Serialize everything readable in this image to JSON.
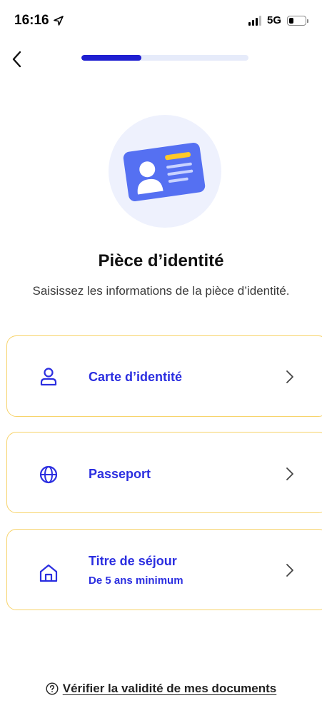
{
  "status_bar": {
    "time": "16:16",
    "location_icon": "location-arrow-icon",
    "network": "5G",
    "battery_level": 0.3
  },
  "nav": {
    "back_icon": "chevron-left-icon",
    "progress": 0.36
  },
  "hero": {
    "icon": "id-card-icon"
  },
  "header": {
    "title": "Pièce d’identité",
    "subtitle": "Saisissez les informations de la pièce d’identité."
  },
  "options": [
    {
      "label": "Carte d’identité",
      "icon": "user-icon"
    },
    {
      "label": "Passeport",
      "icon": "globe-icon"
    },
    {
      "label": "Titre de séjour",
      "sublabel": "De 5 ans minimum",
      "icon": "home-icon"
    }
  ],
  "footer": {
    "link": "Vérifier la validité de mes documents",
    "icon": "help-circle-icon"
  },
  "colors": {
    "accent": "#2b2ee0",
    "progress": "#1f1fd1",
    "card_border": "#f7d36a",
    "hero_bg": "#eef1fd"
  }
}
